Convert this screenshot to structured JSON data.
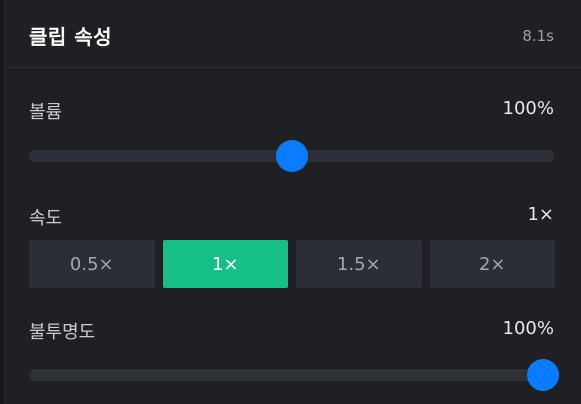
{
  "header": {
    "title": "클립 속성",
    "duration": "8.1s"
  },
  "volume": {
    "label": "볼륨",
    "value_text": "100%",
    "level": 0.5
  },
  "speed": {
    "label": "속도",
    "value_text": "1×",
    "options": [
      "0.5×",
      "1×",
      "1.5×",
      "2×"
    ],
    "selected_index": 1
  },
  "opacity": {
    "label": "불투명도",
    "value_text": "100%",
    "level": 1.0
  },
  "colors": {
    "accent_blue": "#0a7cff",
    "active_green": "#14c087",
    "panel_bg": "#1e2024"
  }
}
